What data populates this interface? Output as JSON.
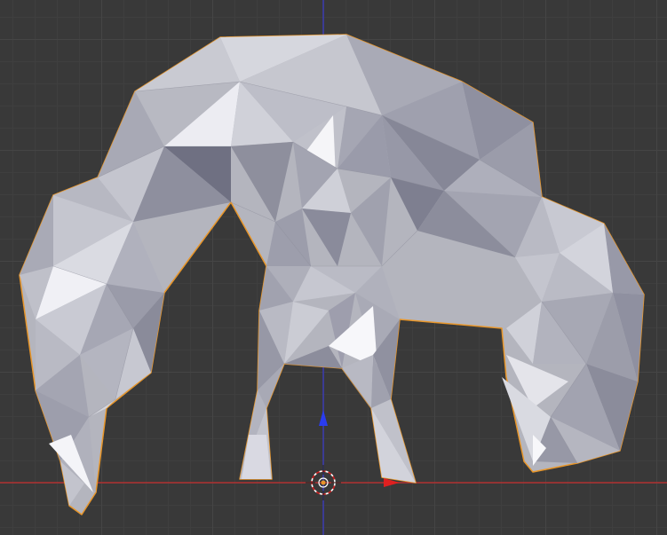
{
  "viewport": {
    "mode": "3D Viewport",
    "background_color": "#393939",
    "grid_color": "#454545"
  },
  "axes": {
    "x_axis_color": "#b03030",
    "y_axis_color": "#3a3ab0"
  },
  "object": {
    "type": "low-poly creature mesh",
    "selected": true,
    "outline_color": "#e8962a",
    "base_color": "#c2c3cc"
  },
  "icons": {
    "cursor": "3d-cursor-icon",
    "gizmo_z": "gizmo-z-arrow-icon",
    "gizmo_x": "gizmo-x-arrow-icon"
  }
}
